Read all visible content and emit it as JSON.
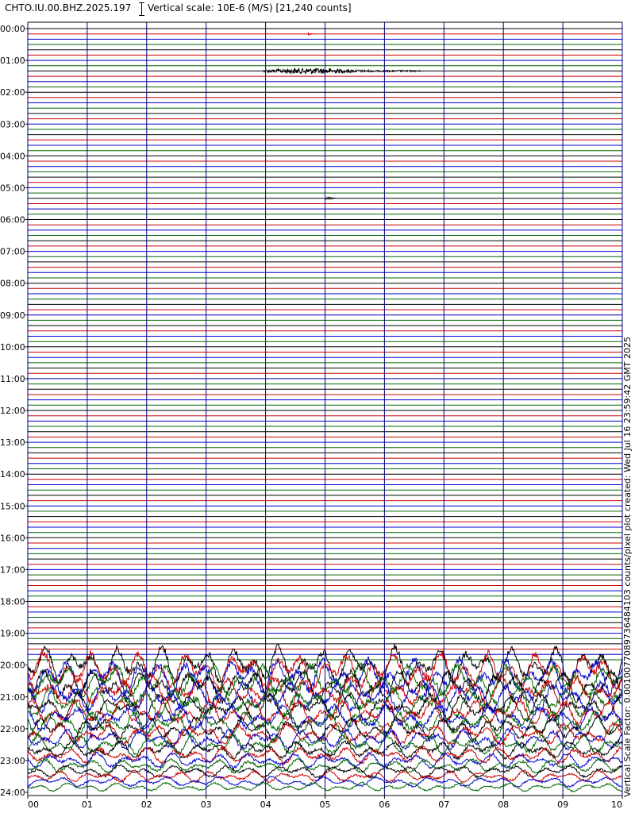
{
  "header": {
    "station": "CHTO.IU.00.BHZ.2025.197",
    "scale": "Vertical scale: 10E-6 (M/S) [21,240 counts]"
  },
  "side_note": "Vertical Scale Factor: 0.0010077089736484103 counts/pixel plot created: Wed Jul 16 23:59:42 GMT 2025",
  "colors": {
    "trace_cycle": [
      "#000000",
      "#cc0000",
      "#0000cc",
      "#006600"
    ],
    "grid": "#00007a",
    "frame": "#000000"
  },
  "chart_data": {
    "type": "line",
    "subtype": "helicorder",
    "title": "CHTO.IU.00.BHZ.2025.197",
    "xlabel": "",
    "ylabel": "",
    "x_ticks": [
      "00",
      "01",
      "02",
      "03",
      "04",
      "05",
      "06",
      "07",
      "08",
      "09",
      "10"
    ],
    "y_ticks": [
      "00:00",
      "01:00",
      "02:00",
      "03:00",
      "04:00",
      "05:00",
      "06:00",
      "07:00",
      "08:00",
      "09:00",
      "10:00",
      "11:00",
      "12:00",
      "13:00",
      "14:00",
      "15:00",
      "16:00",
      "17:00",
      "18:00",
      "19:00",
      "20:00",
      "21:00",
      "22:00",
      "23:00",
      "24:00"
    ],
    "xlim": [
      0,
      10
    ],
    "ylim_hours": [
      0,
      24
    ],
    "minutes_per_line": 10,
    "lines_per_hour": 6,
    "units": "M/S",
    "vertical_scale": "10E-6",
    "scale_counts": 21240,
    "grid": true,
    "events": [
      {
        "row": 1,
        "start_min": 4.7,
        "end_min": 4.8,
        "amplitude": 0.45
      },
      {
        "row": 8,
        "start_min": 3.95,
        "end_min": 6.6,
        "amplitude": 1.0
      },
      {
        "row": 11,
        "start_min": 8.05,
        "end_min": 8.1,
        "amplitude": 0.25
      },
      {
        "row": 32,
        "start_min": 5.0,
        "end_min": 5.2,
        "amplitude": 0.45
      }
    ],
    "noise_onset_row": 120,
    "noise_onset_min": 0.0
  }
}
